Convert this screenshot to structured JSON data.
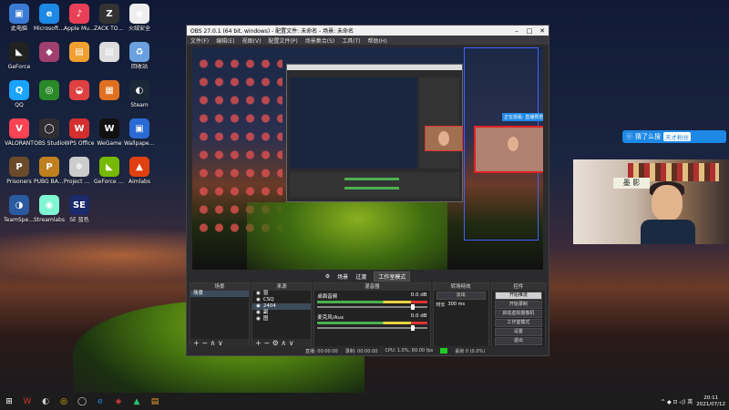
{
  "desktop": {
    "icons": [
      {
        "label": "此电脑",
        "glyph": "▣",
        "color": "#3a7bd5"
      },
      {
        "label": "Microsoft Edge",
        "glyph": "e",
        "color": "#1e88e5"
      },
      {
        "label": "Apple Music",
        "glyph": "♪",
        "color": "#e94057"
      },
      {
        "label": "ZACK TOOL",
        "glyph": "Z",
        "color": "#333"
      },
      {
        "label": "火绒安全",
        "glyph": "◉",
        "color": "#eee"
      },
      {
        "label": "GeForce",
        "glyph": "◣",
        "color": "#222"
      },
      {
        "label": "",
        "glyph": "◆",
        "color": "#a04070"
      },
      {
        "label": "",
        "glyph": "▤",
        "color": "#f0a030"
      },
      {
        "label": "",
        "glyph": "▤",
        "color": "#ddd"
      },
      {
        "label": "回收站",
        "glyph": "♻",
        "color": "#6aa0e0"
      },
      {
        "label": "QQ",
        "glyph": "Q",
        "color": "#1aa3ff"
      },
      {
        "label": "",
        "glyph": "◎",
        "color": "#2a8a2a"
      },
      {
        "label": "",
        "glyph": "◒",
        "color": "#e04040"
      },
      {
        "label": "",
        "glyph": "▦",
        "color": "#e07020"
      },
      {
        "label": "Steam",
        "glyph": "◐",
        "color": "#1b2838"
      },
      {
        "label": "VALORANT",
        "glyph": "V",
        "color": "#fa4454"
      },
      {
        "label": "OBS Studio",
        "glyph": "◯",
        "color": "#302e31"
      },
      {
        "label": "WPS Office",
        "glyph": "W",
        "color": "#d32f2f"
      },
      {
        "label": "WeGame",
        "glyph": "W",
        "color": "#111"
      },
      {
        "label": "Wallpaper Engine",
        "glyph": "▣",
        "color": "#2a6ad5"
      },
      {
        "label": "Prisoners",
        "glyph": "P",
        "color": "#6a4a2a"
      },
      {
        "label": "PUBG BATTLEGROUNDS",
        "glyph": "P",
        "color": "#c08020"
      },
      {
        "label": "Project Winter",
        "glyph": "❄",
        "color": "#ccc"
      },
      {
        "label": "GeForce Experience",
        "glyph": "◣",
        "color": "#76b900"
      },
      {
        "label": "Aimlabs",
        "glyph": "▲",
        "color": "#e04010"
      },
      {
        "label": "TeamSpeak",
        "glyph": "◑",
        "color": "#2a5aa0"
      },
      {
        "label": "Streamlabs",
        "glyph": "◉",
        "color": "#80f5d2"
      },
      {
        "label": "SE 蓝色",
        "glyph": "SE",
        "color": "#1a2a6a"
      }
    ]
  },
  "obs": {
    "title": "OBS 27.0.1 (64 bit, windows) - 配置文件: 未命名 - 场景: 未命名",
    "menu": [
      "文件(F)",
      "编辑(E)",
      "视图(V)",
      "配置文件(P)",
      "场景集合(S)",
      "工具(T)",
      "帮助(H)"
    ],
    "preview_label": "正在观看: 直播预览",
    "mode_buttons": {
      "scene": "场景",
      "transition": "过渡",
      "studio": "工作室模式"
    },
    "docks": {
      "scenes": {
        "title": "场景",
        "items": [
          "场景"
        ]
      },
      "sources": {
        "title": "来源",
        "items": [
          "窗",
          "CSQ",
          "2404",
          "副",
          "图"
        ]
      },
      "mixer": {
        "title": "混音器",
        "tracks": [
          {
            "name": "桌面音频",
            "db": "0.0 dB"
          },
          {
            "name": "麦克风/Aux",
            "db": "0.0 dB"
          }
        ]
      },
      "transitions": {
        "title": "转场特效",
        "type": "淡出",
        "duration_label": "时长",
        "duration": "300 ms"
      },
      "controls": {
        "title": "控件",
        "buttons": [
          "开始推流",
          "开始录制",
          "启动虚拟摄像机",
          "工作室模式",
          "设置",
          "退出"
        ]
      }
    },
    "status": {
      "live": "直播: 00:00:00",
      "rec": "录制: 00:00:00",
      "cpu": "CPU: 1.0%, 60.00 fps",
      "frames": "丢帧 0 (0.0%)"
    }
  },
  "chat_overlay": {
    "text": "猜了么搜",
    "badge": "天才粉丝"
  },
  "taskbar": {
    "apps": [
      {
        "glyph": "⊞",
        "color": "#fff",
        "name": "start"
      },
      {
        "glyph": "W",
        "color": "#d32f2f",
        "name": "wps"
      },
      {
        "glyph": "◐",
        "color": "#ccc",
        "name": "steam"
      },
      {
        "glyph": "◎",
        "color": "#f0c000",
        "name": "chrome"
      },
      {
        "glyph": "◯",
        "color": "#ddd",
        "name": "obs"
      },
      {
        "glyph": "e",
        "color": "#1e88e5",
        "name": "edge"
      },
      {
        "glyph": "◈",
        "color": "#e04040",
        "name": "netease"
      },
      {
        "glyph": "▲",
        "color": "#2ac070",
        "name": "app"
      },
      {
        "glyph": "▤",
        "color": "#f0a030",
        "name": "folder"
      }
    ],
    "time": "20:11",
    "date": "2021/07/12",
    "tray": "^ ◆ ⊡ ◁) 英"
  }
}
